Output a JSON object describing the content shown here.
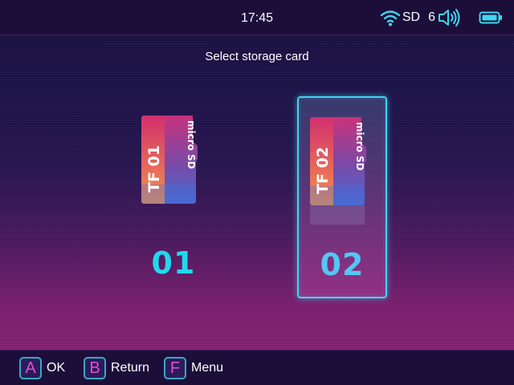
{
  "status_bar": {
    "time": "17:45",
    "sd_label": "SD",
    "volume_level": "6",
    "icons": [
      "wifi-icon",
      "volume-icon",
      "battery-icon"
    ]
  },
  "screen": {
    "title": "Select storage card"
  },
  "slots": [
    {
      "card_label": "TF 01",
      "brand": "micro SD",
      "number": "01",
      "selected": false
    },
    {
      "card_label": "TF 02",
      "brand": "micro SD",
      "number": "02",
      "selected": true
    }
  ],
  "footer": {
    "hints": [
      {
        "key": "A",
        "label": "OK"
      },
      {
        "key": "B",
        "label": "Return"
      },
      {
        "key": "F",
        "label": "Menu"
      }
    ]
  },
  "colors": {
    "accent": "#3fd6ee",
    "key_letter": "#e04fd8",
    "card_orange": "#f2744a",
    "card_magenta": "#c8327a",
    "card_purple": "#7a4aa8",
    "card_blue": "#4a6ad0"
  }
}
